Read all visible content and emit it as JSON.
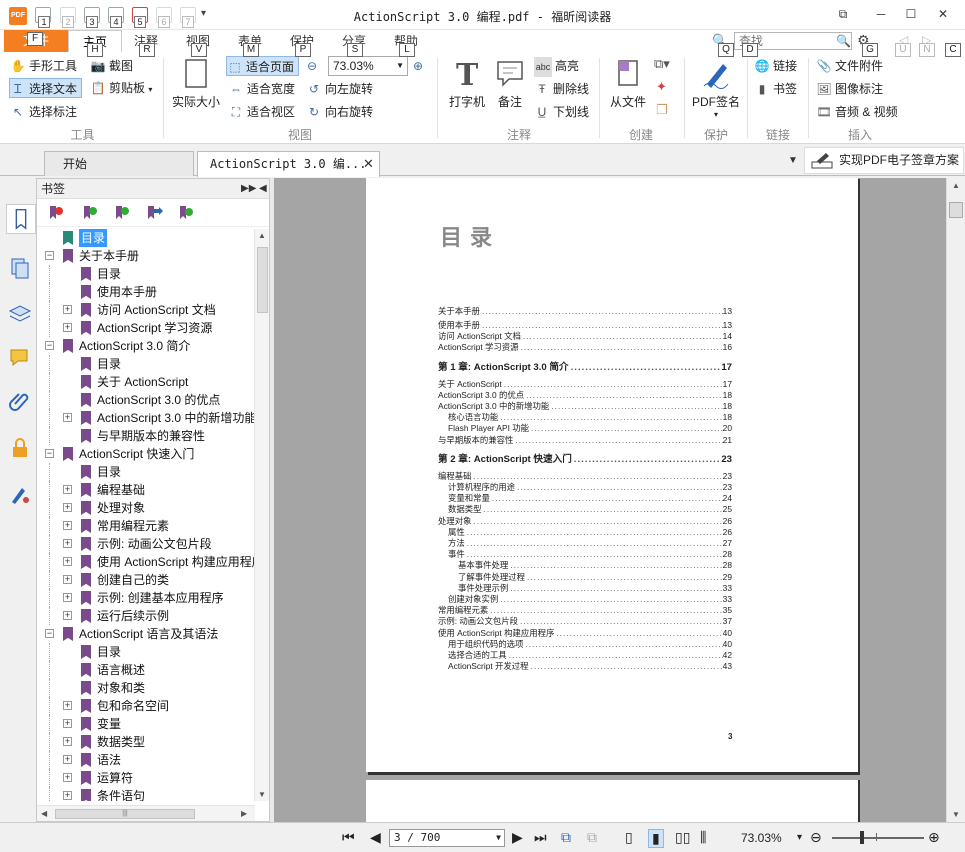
{
  "window": {
    "title": "ActionScript 3.0 编程.pdf - 福昕阅读器",
    "logo_text": "PDF",
    "quick_access_keys": [
      "1",
      "2",
      "3",
      "4",
      "5",
      "6",
      "7"
    ],
    "more_arrow": "▾",
    "minimize": "─",
    "maximize": "☐",
    "close": "✕",
    "restore": "⧉"
  },
  "menu": {
    "file": "文件",
    "file_keytip": "F",
    "tabs": [
      {
        "label": "主页",
        "keytip": "H"
      },
      {
        "label": "注释",
        "keytip": "R"
      },
      {
        "label": "视图",
        "keytip": "V"
      },
      {
        "label": "表单",
        "keytip": "M"
      },
      {
        "label": "保护",
        "keytip": "P"
      },
      {
        "label": "分享",
        "keytip": "S"
      },
      {
        "label": "帮助",
        "keytip": "L"
      }
    ],
    "search_placeholder": "查找",
    "search_keytip": "Q",
    "search_options_keytip": "D",
    "settings_keytip": "G",
    "nav_keytips": [
      "U",
      "N",
      "C"
    ],
    "search_icon": "🔍",
    "settings_icon": "⚙"
  },
  "ribbon": {
    "tools": {
      "hand": "手形工具",
      "select_text": "选择文本",
      "select_annotation": "选择标注",
      "snapshot": "截图",
      "clipboard": "剪贴板",
      "group": "工具"
    },
    "view": {
      "actual_size": "实际大小",
      "fit_page": "适合页面",
      "fit_width": "适合宽度",
      "fit_visible": "适合视区",
      "zoom_value": "73.03%",
      "rotate_left": "向左旋转",
      "rotate_right": "向右旋转",
      "group": "视图"
    },
    "annotate": {
      "typewriter": "打字机",
      "note": "备注",
      "highlight": "高亮",
      "strikeout": "删除线",
      "underline": "下划线",
      "highlight_icon_text": "abc",
      "group": "注释"
    },
    "create": {
      "from_file": "从文件",
      "group": "创建"
    },
    "protect": {
      "sign": "PDF签名",
      "group": "保护"
    },
    "links": {
      "link": "链接",
      "bookmark": "书签",
      "group": "链接"
    },
    "insert": {
      "attachment": "文件附件",
      "image": "图像标注",
      "audio_video": "音频 & 视频",
      "group": "插入"
    }
  },
  "doc_tabs": {
    "start": "开始",
    "current": "ActionScript 3.0 编...",
    "close": "✕",
    "list_arrow": "▼",
    "promo": "实现PDF电子签章方案"
  },
  "bookmarks": {
    "title": "书签",
    "header_controls": [
      "▶▶",
      "◀"
    ],
    "items": [
      {
        "label": "目录",
        "level": 0,
        "exp": "",
        "sel": true
      },
      {
        "label": "关于本手册",
        "level": 0,
        "exp": "−"
      },
      {
        "label": "目录",
        "level": 1,
        "exp": ""
      },
      {
        "label": "使用本手册",
        "level": 1,
        "exp": ""
      },
      {
        "label": "访问 ActionScript 文档",
        "level": 1,
        "exp": "+"
      },
      {
        "label": "ActionScript 学习资源",
        "level": 1,
        "exp": "+"
      },
      {
        "label": "ActionScript 3.0 简介",
        "level": 0,
        "exp": "−"
      },
      {
        "label": "目录",
        "level": 1,
        "exp": ""
      },
      {
        "label": "关于 ActionScript",
        "level": 1,
        "exp": ""
      },
      {
        "label": "ActionScript 3.0 的优点",
        "level": 1,
        "exp": ""
      },
      {
        "label": "ActionScript 3.0 中的新增功能",
        "level": 1,
        "exp": "+"
      },
      {
        "label": "与早期版本的兼容性",
        "level": 1,
        "exp": ""
      },
      {
        "label": "ActionScript 快速入门",
        "level": 0,
        "exp": "−"
      },
      {
        "label": "目录",
        "level": 1,
        "exp": ""
      },
      {
        "label": "编程基础",
        "level": 1,
        "exp": "+"
      },
      {
        "label": "处理对象",
        "level": 1,
        "exp": "+"
      },
      {
        "label": "常用编程元素",
        "level": 1,
        "exp": "+"
      },
      {
        "label": "示例: 动画公文包片段",
        "level": 1,
        "exp": "+"
      },
      {
        "label": "使用 ActionScript 构建应用程序",
        "level": 1,
        "exp": "+"
      },
      {
        "label": "创建自己的类",
        "level": 1,
        "exp": "+"
      },
      {
        "label": "示例: 创建基本应用程序",
        "level": 1,
        "exp": "+"
      },
      {
        "label": "运行后续示例",
        "level": 1,
        "exp": "+"
      },
      {
        "label": "ActionScript 语言及其语法",
        "level": 0,
        "exp": "−"
      },
      {
        "label": "目录",
        "level": 1,
        "exp": ""
      },
      {
        "label": "语言概述",
        "level": 1,
        "exp": ""
      },
      {
        "label": "对象和类",
        "level": 1,
        "exp": ""
      },
      {
        "label": "包和命名空间",
        "level": 1,
        "exp": "+"
      },
      {
        "label": "变量",
        "level": 1,
        "exp": "+"
      },
      {
        "label": "数据类型",
        "level": 1,
        "exp": "+"
      },
      {
        "label": "语法",
        "level": 1,
        "exp": "+"
      },
      {
        "label": "运算符",
        "level": 1,
        "exp": "+"
      },
      {
        "label": "条件语句",
        "level": 1,
        "exp": "+"
      }
    ]
  },
  "page": {
    "title": "目录",
    "number": "3",
    "toc": [
      {
        "t": "关于本手册",
        "p": "13",
        "cls": "sec",
        "ind": 0
      },
      {
        "t": "使用本手册",
        "p": "13",
        "cls": "",
        "ind": 0
      },
      {
        "t": "访问 ActionScript 文档",
        "p": "14",
        "cls": "",
        "ind": 0
      },
      {
        "t": "ActionScript 学习资源",
        "p": "16",
        "cls": "",
        "ind": 0
      },
      {
        "t": "第 1 章: ActionScript 3.0 简介",
        "p": "17",
        "cls": "chapter",
        "ind": 0
      },
      {
        "t": "关于 ActionScript",
        "p": "17",
        "cls": "",
        "ind": 0
      },
      {
        "t": "ActionScript 3.0 的优点",
        "p": "18",
        "cls": "",
        "ind": 0
      },
      {
        "t": "ActionScript 3.0 中的新增功能",
        "p": "18",
        "cls": "",
        "ind": 0
      },
      {
        "t": "核心语言功能",
        "p": "18",
        "cls": "",
        "ind": 1
      },
      {
        "t": "Flash Player API 功能",
        "p": "20",
        "cls": "",
        "ind": 1
      },
      {
        "t": "与早期版本的兼容性",
        "p": "21",
        "cls": "",
        "ind": 0
      },
      {
        "t": "第 2 章: ActionScript 快速入门",
        "p": "23",
        "cls": "chapter",
        "ind": 0
      },
      {
        "t": "编程基础",
        "p": "23",
        "cls": "",
        "ind": 0
      },
      {
        "t": "计算机程序的用途",
        "p": "23",
        "cls": "",
        "ind": 1
      },
      {
        "t": "变量和常量",
        "p": "24",
        "cls": "",
        "ind": 1
      },
      {
        "t": "数据类型",
        "p": "25",
        "cls": "",
        "ind": 1
      },
      {
        "t": "处理对象",
        "p": "26",
        "cls": "",
        "ind": 0
      },
      {
        "t": "属性",
        "p": "26",
        "cls": "",
        "ind": 1
      },
      {
        "t": "方法",
        "p": "27",
        "cls": "",
        "ind": 1
      },
      {
        "t": "事件",
        "p": "28",
        "cls": "",
        "ind": 1
      },
      {
        "t": "基本事件处理",
        "p": "28",
        "cls": "",
        "ind": 2
      },
      {
        "t": "了解事件处理过程",
        "p": "29",
        "cls": "",
        "ind": 2
      },
      {
        "t": "事件处理示例",
        "p": "33",
        "cls": "",
        "ind": 2
      },
      {
        "t": "创建对象实例",
        "p": "33",
        "cls": "",
        "ind": 1
      },
      {
        "t": "常用编程元素",
        "p": "35",
        "cls": "",
        "ind": 0
      },
      {
        "t": "示例: 动画公文包片段",
        "p": "37",
        "cls": "",
        "ind": 0
      },
      {
        "t": "使用 ActionScript 构建应用程序",
        "p": "40",
        "cls": "",
        "ind": 0
      },
      {
        "t": "用于组织代码的选项",
        "p": "40",
        "cls": "",
        "ind": 1
      },
      {
        "t": "选择合适的工具",
        "p": "42",
        "cls": "",
        "ind": 1
      },
      {
        "t": "ActionScript 开发过程",
        "p": "43",
        "cls": "",
        "ind": 1
      }
    ]
  },
  "status": {
    "page_field": "3 / 700",
    "zoom": "73.03%",
    "first": "⏮",
    "prev": "◀",
    "next": "▶",
    "last": "⏭",
    "zoom_out": "⊖",
    "zoom_in": "⊕",
    "zoom_dd": "▾"
  }
}
